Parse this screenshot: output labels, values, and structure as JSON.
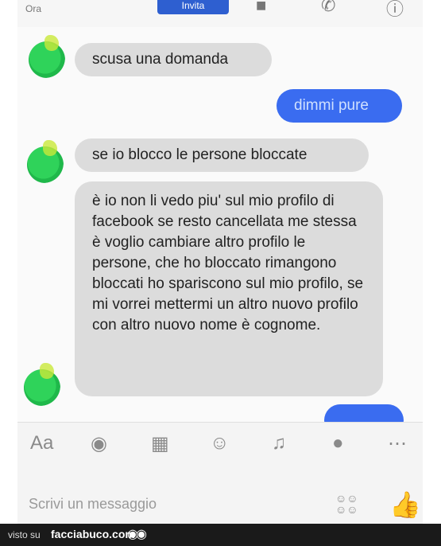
{
  "status": {
    "time": "Ora"
  },
  "header": {
    "invite_label": "Invita",
    "video_icon": "video-camera-icon",
    "call_icon": "phone-icon",
    "info_icon": "info-icon"
  },
  "messages": [
    {
      "from": "them",
      "text": "scusa una domanda"
    },
    {
      "from": "me",
      "text": "dimmi pure"
    },
    {
      "from": "them",
      "text": "se io blocco le persone  bloccate"
    },
    {
      "from": "them",
      "text": "è io non li vedo piu' sul mio profilo di facebook se resto cancellata me stessa è voglio cambiare altro profilo le persone, che ho bloccato rimangono bloccati ho spariscono sul mio profilo, se mi vorrei mettermi un altro nuovo profilo con altro nuovo nome è cognome."
    }
  ],
  "composer": {
    "tools": [
      "Aa",
      "camera-icon",
      "image-icon",
      "emoji-icon",
      "microphone-icon",
      "location-icon",
      "more-icon"
    ],
    "tools_text": "Aa",
    "placeholder": "Scrivi un messaggio",
    "like_icon": "thumbs-up-icon"
  },
  "footer": {
    "prefix": "visto su",
    "brand": "facciabuco.com"
  },
  "colors": {
    "my_bubble": "#3a6cf0",
    "their_bubble": "#dcdcdc",
    "accent": "#2e63d8"
  }
}
